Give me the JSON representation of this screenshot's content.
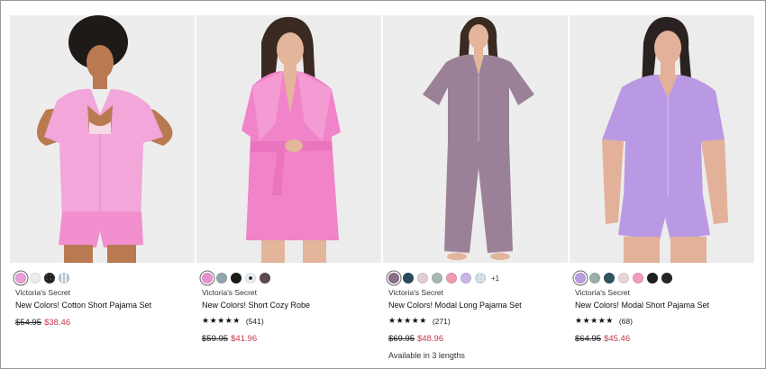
{
  "products": [
    {
      "brand": "Victoria's Secret",
      "name": "New Colors! Cotton Short Pajama Set",
      "original_price": "$54.95",
      "sale_price": "$38.46",
      "swatches": [
        "#e8a0d8",
        "#ededed",
        "#222222",
        "#b8c7d2"
      ],
      "selected_swatch": 0,
      "photo_bg": "#ededed",
      "garment_color": "#f2a6d9"
    },
    {
      "brand": "Victoria's Secret",
      "name": "New Colors! Short Cozy Robe",
      "rating_stars": "★★★★★",
      "rating_count": "(541)",
      "original_price": "$59.95",
      "sale_price": "$41.96",
      "swatches": [
        "#e694cf",
        "#8fa6aa",
        "#1a1a1a",
        "#e8eef2",
        "#5a4a52"
      ],
      "selected_swatch": 0,
      "photo_bg": "#ececec",
      "garment_color": "#f183c9"
    },
    {
      "brand": "Victoria's Secret",
      "name": "New Colors! Modal Long Pajama Set",
      "rating_stars": "★★★★★",
      "rating_count": "(271)",
      "original_price": "$69.95",
      "sale_price": "$48.96",
      "swatches": [
        "#8a6f86",
        "#2c4a5e",
        "#e3cfd3",
        "#a8b8b0",
        "#ee9bb4",
        "#c7b6e6",
        "#d6e2ea"
      ],
      "more_colors": "+1",
      "selected_swatch": 0,
      "lengths_note": "Available in 3 lengths",
      "photo_bg": "#ededed",
      "garment_color": "#9b8198"
    },
    {
      "brand": "Victoria's Secret",
      "name": "New Colors! Modal Short Pajama Set",
      "rating_stars": "★★★★★",
      "rating_count": "(68)",
      "original_price": "$64.95",
      "sale_price": "$45.46",
      "swatches": [
        "#b99ee0",
        "#9aaea8",
        "#2c5560",
        "#e6d6d8",
        "#f09cbc",
        "#1e1e1e",
        "#262626"
      ],
      "selected_swatch": 0,
      "photo_bg": "#ececec",
      "garment_color": "#b999e3"
    }
  ],
  "colors": {
    "sale": "#c0394b"
  }
}
